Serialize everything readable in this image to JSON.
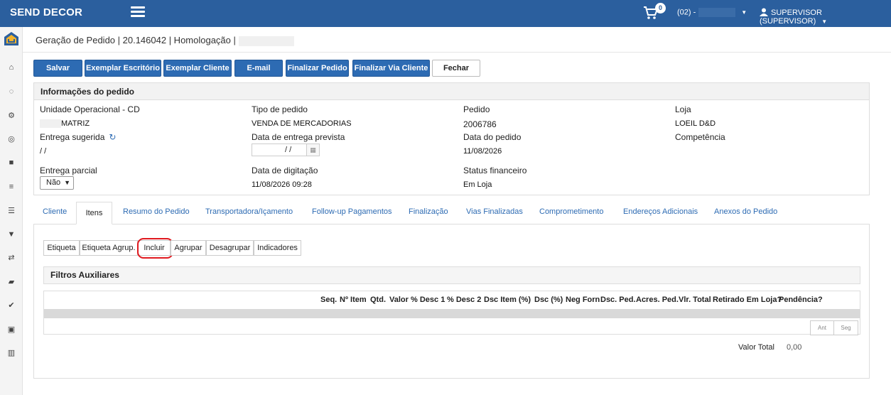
{
  "topbar": {
    "brand": "SEND DECOR",
    "cart_count": "0",
    "company": "(02) -",
    "user": "SUPERVISOR (SUPERVISOR)"
  },
  "breadcrumb": "Geração de Pedido | 20.146042 | Homologação |",
  "toolbar": {
    "salvar": "Salvar",
    "exemplar_escritorio": "Exemplar Escritório",
    "exemplar_cliente": "Exemplar Cliente",
    "email": "E-mail",
    "finalizar_pedido": "Finalizar Pedido",
    "finalizar_via_cliente": "Finalizar Via Cliente",
    "fechar": "Fechar"
  },
  "info": {
    "title": "Informações do pedido",
    "unidade_label": "Unidade Operacional - CD",
    "unidade_value": "MATRIZ",
    "tipo_label": "Tipo de pedido",
    "tipo_value": "VENDA DE MERCADORIAS",
    "pedido_label": "Pedido",
    "pedido_value": "2006786",
    "loja_label": "Loja",
    "loja_value": "LOEIL D&D",
    "entrega_sugerida_label": "Entrega sugerida",
    "entrega_sugerida_value": "/ /",
    "entrega_prevista_label": "Data de entrega prevista",
    "entrega_prevista_value": "/ /",
    "data_pedido_label": "Data do pedido",
    "data_pedido_value": "11/08/2026",
    "competencia_label": "Competência",
    "entrega_parcial_label": "Entrega parcial",
    "entrega_parcial_value": "Não",
    "digitacao_label": "Data de digitação",
    "digitacao_value": "11/08/2026 09:28",
    "status_label": "Status financeiro",
    "status_value": "Em Loja"
  },
  "tabs": {
    "cliente": "Cliente",
    "itens": "Itens",
    "resumo": "Resumo do Pedido",
    "transportadora": "Transportadora/Içamento",
    "followup": "Follow-up Pagamentos",
    "finalizacao": "Finalização",
    "vias": "Vias Finalizadas",
    "comprometimento": "Comprometimento",
    "enderecos": "Endereços Adicionais",
    "anexos": "Anexos do Pedido"
  },
  "items_toolbar": {
    "etiqueta": "Etiqueta",
    "etiqueta_agrup": "Etiqueta Agrup.",
    "incluir": "Incluir",
    "agrupar": "Agrupar",
    "desagrupar": "Desagrupar",
    "indicadores": "Indicadores"
  },
  "filtros_title": "Filtros Auxiliares",
  "grid": {
    "columns": [
      "Seq.",
      "Nº Item",
      "Qtd.",
      "Valor",
      "% Desc 1",
      "% Desc 2",
      "Dsc Item (%)",
      "Dsc (%)",
      "Neg Forn",
      "Dsc. Ped.",
      "Acres. Ped.",
      "Vlr. Total",
      "Retirado Em Loja?",
      "Pendência?"
    ]
  },
  "pager": {
    "prev": "Ant",
    "next": "Seg"
  },
  "total": {
    "label": "Valor Total",
    "value": "0,00"
  }
}
